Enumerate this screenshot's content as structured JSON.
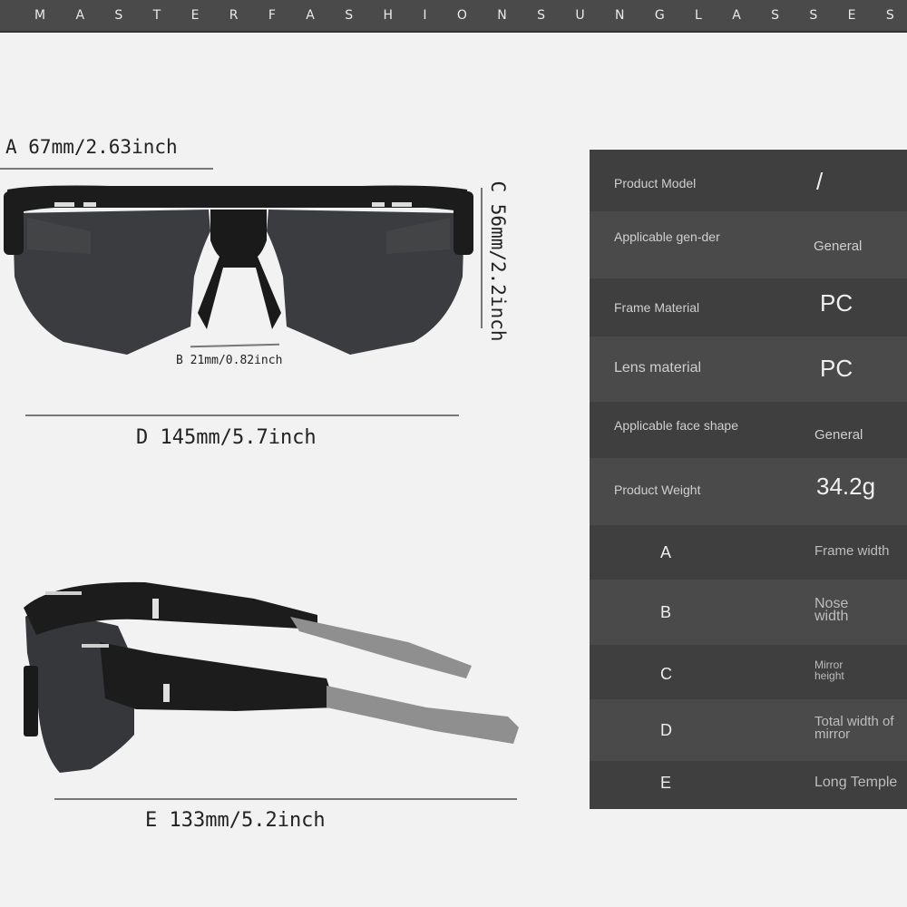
{
  "banner": {
    "letters": [
      "M",
      "A",
      "S",
      "T",
      "E",
      "R",
      "F",
      "A",
      "S",
      "H",
      "I",
      "O",
      "N",
      "S",
      "U",
      "N",
      "G",
      "L",
      "A",
      "S",
      "S",
      "E",
      "S"
    ]
  },
  "dimensions": {
    "a": "A 67mm/2.63inch",
    "b": "B 21mm/0.82inch",
    "c": "C 56mm/2.2inch",
    "d": "D 145mm/5.7inch",
    "e": "E 133mm/5.2inch"
  },
  "specs": [
    {
      "label": "Product Model",
      "value": "/"
    },
    {
      "label": "Applicable gen-der",
      "value": "General"
    },
    {
      "label": "Frame Material",
      "value": "PC"
    },
    {
      "label": "Lens material",
      "value": "PC"
    },
    {
      "label": "Applicable face shape",
      "value": "General"
    },
    {
      "label": "Product Weight",
      "value": "34.2g"
    }
  ],
  "legend": [
    {
      "letter": "A",
      "desc": "Frame width"
    },
    {
      "letter": "B",
      "desc": "Nose width"
    },
    {
      "letter": "C",
      "desc": "Mirror height"
    },
    {
      "letter": "D",
      "desc": "Total width of mirror"
    },
    {
      "letter": "E",
      "desc": "Long Temple"
    }
  ],
  "colors": {
    "banner": "#4a4a4a",
    "table": "#444444",
    "frame": "#1c1c1c",
    "lens": "#3a3c40",
    "temple_tip": "#8f8f8f"
  }
}
